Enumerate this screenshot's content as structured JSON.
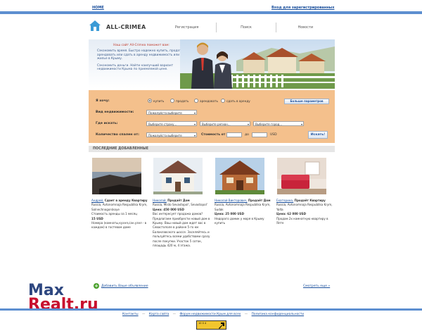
{
  "top": {
    "home": "HOME",
    "login": "Вход для зарегистрированных"
  },
  "header": {
    "logo": "ALL-CRIMEA",
    "nav": [
      "Регистрация",
      "Поиск",
      "Новости"
    ]
  },
  "banner": {
    "headline": "Наш сайт All-Crimea поможет вам:",
    "p1": "Сэкономить время. Быстро надежно купить, продать, арендовать или сдать в аренду недвижимость или жилье в Крыму.",
    "p2": "Сэкономить деньги. Найти наилучший вариант недвижимости Крыма по приемлемой цене."
  },
  "search": {
    "want_label": "Я хочу:",
    "options": [
      "купить",
      "продать",
      "арендовать",
      "сдать в аренду"
    ],
    "selected": 0,
    "more_params": "Больше параметров",
    "type_label": "Вид недвижимости:",
    "type_value": "Пожалуйста выберите",
    "where_label": "Где искать:",
    "country": "Выберите страну...",
    "region": "Выберите регион...",
    "city": "Выберите город...",
    "rooms_label": "Количество спален от:",
    "rooms_value": "Пожалуйста выберите",
    "cost_label": "Стоимость от",
    "to_label": "до",
    "currency": "USD",
    "search_btn": "Искать!"
  },
  "recent": {
    "title": "ПОСЛЕДНИЕ ДОБАВЛЕННЫЕ",
    "items": [
      {
        "author": "Андрей,",
        "title": "Сдает в аренду Квартиру",
        "lines": [
          "Russia, Avtonomnaja Respublika Krym, Solnechnogorskoye",
          "Стоимость аренды за 1 месяц"
        ],
        "price": "15 USD",
        "desc": "Номера (комнаты,кухня,сан.узел - в каждом) в гостевом доме"
      },
      {
        "author": "Николай,",
        "title": "Продаёт Дом",
        "lines": [
          "Russia, Misto Sevastopol', Sevastopol'"
        ],
        "price": "Цена: 450 000 USD",
        "desc": "Вас интересует продажа домов? Предлагаем приобрести новый дом в Крыму. Ваш новый дом ждет вас в Севастополе в районе 5-го км Балаклавского шоссе. Заселяйтесь и пользуйтесь всеми удобствами сразу после покупки. Участок 5 соток, площадь 420 м, 4 этажа."
      },
      {
        "author": "Николай Викторович,",
        "title": "Продаёт Дом",
        "lines": [
          "Russia, Avtonomnaja Respublika Krym, Sudak"
        ],
        "price": "Цена: 25 000 USD",
        "desc": "Недорого домик у моря в Крыму купить"
      },
      {
        "author": "Екатерина,",
        "title": "Продаёт Квартиру",
        "lines": [
          "Russia, Avtonomnaja Respublika Krym, Yalta"
        ],
        "price": "Цена: 62 000 USD",
        "desc": "Продам 2х комнатную квартиру в Ялте"
      }
    ]
  },
  "actions": {
    "add": "Добавить Ваше объявление",
    "more": "Смотреть еще »"
  },
  "footer": {
    "links": [
      "Контакты",
      "Карта сайта",
      "Форум недвижимости Крым для всех",
      "Политика конфиденциальности"
    ],
    "sep": "—"
  },
  "watermark": {
    "line1": "Max",
    "line2": "Realt.ru"
  },
  "counter": {
    "text": "10 0 4"
  },
  "colors": {
    "accent_blue": "#5d8fd0",
    "search_bg": "#f4c08c",
    "watermark_blue": "#2e4780",
    "watermark_red": "#c8102e"
  }
}
